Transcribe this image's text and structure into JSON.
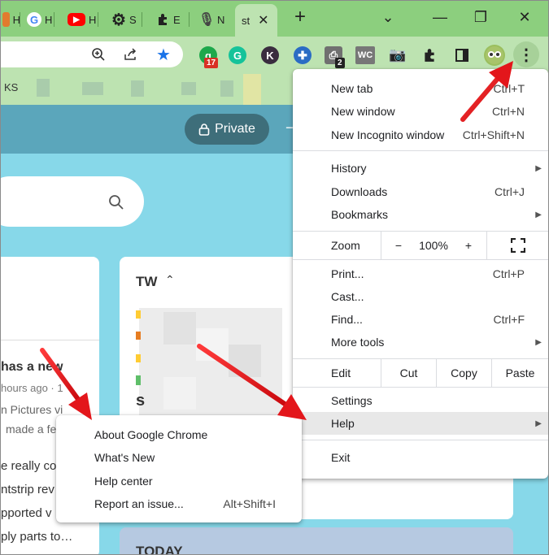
{
  "tabs": [
    {
      "label": "H",
      "icon": "tab-site-icon"
    },
    {
      "label": "H",
      "icon": "google-icon"
    },
    {
      "label": "H",
      "icon": "youtube-icon"
    },
    {
      "label": "S",
      "icon": "gear-icon"
    },
    {
      "label": "E",
      "icon": "puzzle-icon"
    },
    {
      "label": "N",
      "icon": "microphone-icon"
    },
    {
      "label": "st",
      "icon": "tab-page-icon"
    }
  ],
  "window_controls": {
    "new_tab": "+",
    "tab_search": "⌄",
    "restore": "❐",
    "close": "✕"
  },
  "extensions": [
    {
      "name": "grammar-ext-icon",
      "badge": "17",
      "color": "#1ea84b"
    },
    {
      "name": "grammarly-icon",
      "badge": "",
      "color": "#15c39a"
    },
    {
      "name": "k-ext-icon",
      "badge": "",
      "color": "#3a2d3f"
    },
    {
      "name": "blue-ext-icon",
      "badge": "",
      "color": "#2b6cc4"
    },
    {
      "name": "clipboard-ext-icon",
      "badge": "2",
      "color": "#4a4a4a"
    }
  ],
  "bookmarks": {
    "first": "KS"
  },
  "page": {
    "private_label": "Private",
    "card_tw_title": "TW",
    "card_today_title": "TODAY",
    "feed_lines": [
      "has a new",
      "hours ago  ·  1",
      "n Pictures vi",
      "made a fe",
      "e really co",
      "ntstrip rev",
      "pported v",
      "ply parts to…"
    ]
  },
  "menu": {
    "new_tab": "New tab",
    "new_tab_sc": "Ctrl+T",
    "new_window": "New window",
    "new_window_sc": "Ctrl+N",
    "incognito": "New Incognito window",
    "incognito_sc": "Ctrl+Shift+N",
    "history": "History",
    "downloads": "Downloads",
    "downloads_sc": "Ctrl+J",
    "bookmarks": "Bookmarks",
    "zoom": "Zoom",
    "zoom_minus": "−",
    "zoom_value": "100%",
    "zoom_plus": "+",
    "print": "Print...",
    "print_sc": "Ctrl+P",
    "cast": "Cast...",
    "find": "Find...",
    "find_sc": "Ctrl+F",
    "more_tools": "More tools",
    "edit": "Edit",
    "cut": "Cut",
    "copy": "Copy",
    "paste": "Paste",
    "settings": "Settings",
    "help": "Help",
    "exit": "Exit"
  },
  "help_submenu": {
    "about": "About Google Chrome",
    "whats_new": "What's New",
    "help_center": "Help center",
    "report": "Report an issue...",
    "report_sc": "Alt+Shift+I"
  },
  "colors": {
    "annotation_arrow": "#e3161b",
    "tabstrip": "#8ccf7e",
    "toolbar": "#bde3b1",
    "page_bg": "#87d8e9"
  }
}
